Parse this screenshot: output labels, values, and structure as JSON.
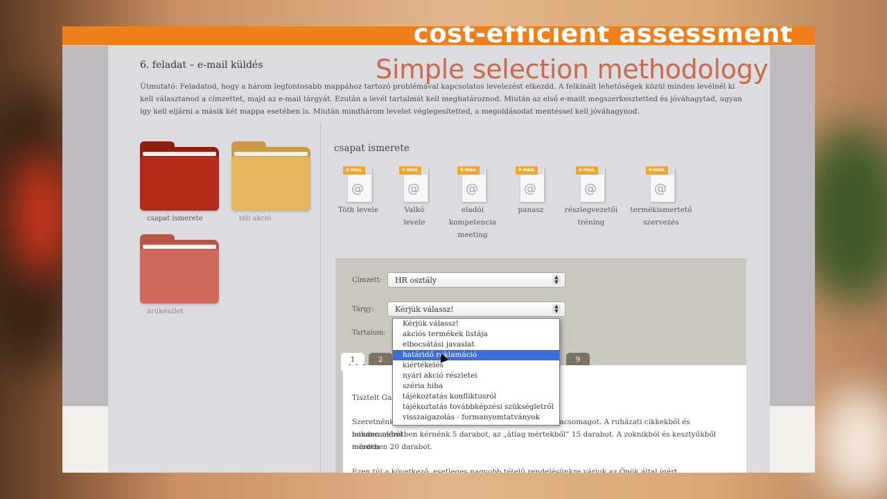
{
  "banner": {
    "title": "cost-efficient assessment",
    "subtitle": "Simple selection methodology"
  },
  "task": {
    "title": "6. feladat – e-mail küldés",
    "instructions": "Útmutató: Feladatod, hogy a három legfontosabb mappához tartozó problémával kapcsolatos levelezést elkezdd. A felkínált lehetőségek közül minden levélnél ki kell választanod a címzettet, majd az e-mail tárgyát. Ezután a levél tartalmát kell meghatároznod. Miután az első e-mailt megszerkesztetted és jóváhagytad, ugyan így kell eljárni a másik két mappa esetében is. Miután mindhárom levelet véglegesítetted, a megoldásodat mentéssel kell jóváhagynod."
  },
  "folders": [
    {
      "label": "csapat ismerete",
      "color": "#b52a1a",
      "tab_color": "#8e1e10",
      "active": true
    },
    {
      "label": "téli akció",
      "color": "#e3b65c",
      "tab_color": "#c99a44",
      "active": false
    },
    {
      "label": "árukészlet",
      "color": "#cf6a5a",
      "tab_color": "#b55648",
      "active": false
    }
  ],
  "section": {
    "title": "csapat ismerete"
  },
  "emails": [
    {
      "badge": "E-MAIL",
      "label_lines": [
        "Tóth levele"
      ]
    },
    {
      "badge": "E-MAIL",
      "label_lines": [
        "Valkó",
        "levele"
      ]
    },
    {
      "badge": "E-MAIL",
      "label_lines": [
        "eladói",
        "kompetencia",
        "meeting"
      ]
    },
    {
      "badge": "E-MAIL",
      "label_lines": [
        "panasz"
      ]
    },
    {
      "badge": "E-MAIL",
      "label_lines": [
        "részlegvezetői",
        "tréning"
      ]
    },
    {
      "badge": "E-MAIL",
      "label_lines": [
        "termékismertető",
        "szervezés"
      ]
    }
  ],
  "form": {
    "recipient_label": "Címzett:",
    "recipient_value": "HR osztály",
    "subject_label": "Tárgy:",
    "subject_value": "Kérjük válassz!",
    "content_label": "Tartalom:"
  },
  "dropdown": {
    "options": [
      "Kérjük válassz!",
      "akciós termékek listája",
      "elbocsátási javaslat",
      "határidő reklamáció",
      "kiértékelés",
      "nyári akció részletei",
      "széria hiba",
      "tájékoztatás konfliktusról",
      "tájékoztatás továbbképzési szükségletről",
      "visszaigazolás - formanyomtatványok"
    ],
    "highlighted_index": 3
  },
  "tabs": {
    "visible": [
      "1",
      "2",
      "9"
    ],
    "active": "1",
    "dots": "• • •"
  },
  "letter": {
    "greeting": "Tisztelt Ga",
    "paragraph1_start": "Szeretnénk",
    "paragraph1_end": "ntacsomagot. A ruházati cikkekből és bakancsokból",
    "paragraph1_line2": "minden méretben kérnénk 5 darabot, az „átlag mértekből” 15 darabot. A zoknikból és kesztyűkből minden",
    "paragraph1_line3": "méretben 20 darabot.",
    "paragraph2": "Ezen túl a következő, esetleges nagyobb tételű rendelésünkre várjuk az Önök által ígért kedvezményes ajánlatot."
  }
}
